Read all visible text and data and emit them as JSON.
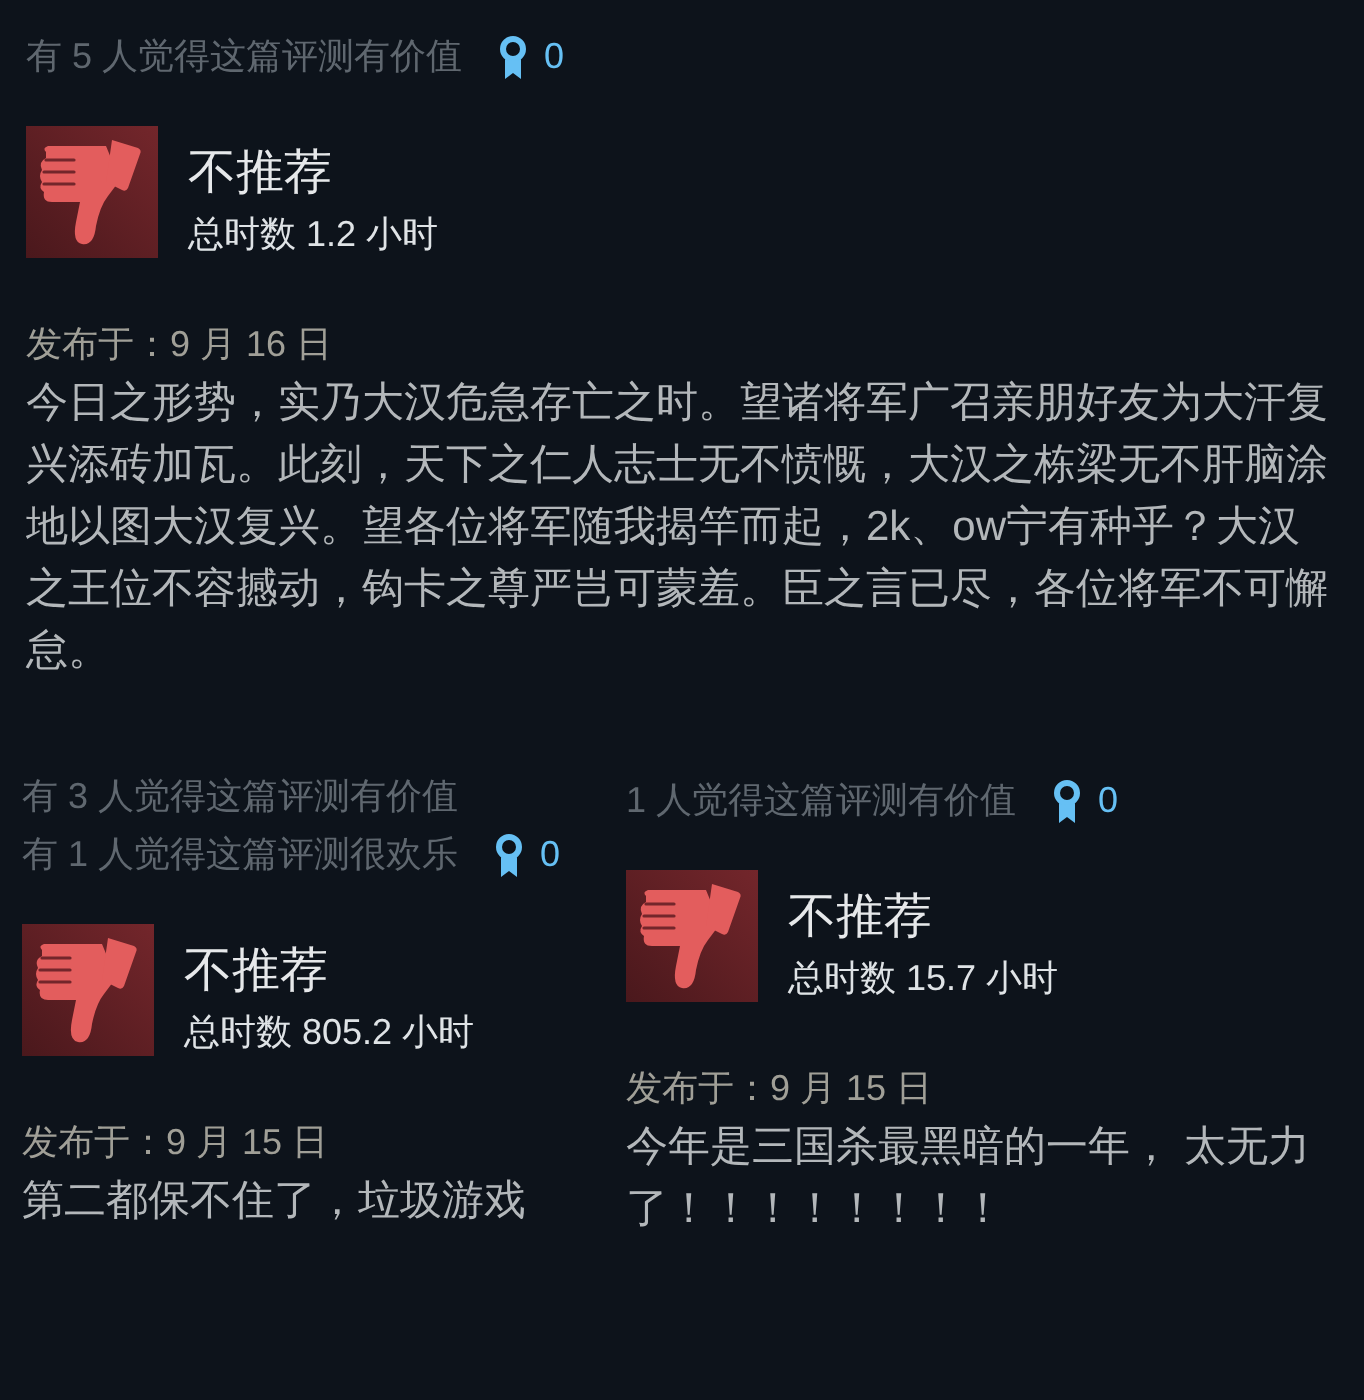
{
  "reviews": [
    {
      "helpful": [
        "有 5 人觉得这篇评测有价值"
      ],
      "awards": "0",
      "recommended": false,
      "verdict": "不推荐",
      "playtime": "总时数 1.2 小时",
      "posted": "发布于：9 月 16 日",
      "body": "今日之形势，实乃大汉危急存亡之时。望诸将军广召亲朋好友为大汗复兴添砖加瓦。此刻，天下之仁人志士无不愤慨，大汉之栋梁无不肝脑涂地以图大汉复兴。望各位将军随我揭竿而起，2k、ow宁有种乎？大汉之王位不容撼动，钩卡之尊严岂可蒙羞。臣之言已尽，各位将军不可懈怠。"
    },
    {
      "helpful": [
        "有 3 人觉得这篇评测有价值",
        "有 1 人觉得这篇评测很欢乐"
      ],
      "awards": "0",
      "recommended": false,
      "verdict": "不推荐",
      "playtime": "总时数 805.2 小时",
      "posted": "发布于：9 月 15 日",
      "body": "第二都保不住了，垃圾游戏"
    },
    {
      "helpful": [
        "1 人觉得这篇评测有价值"
      ],
      "awards": "0",
      "recommended": false,
      "verdict": "不推荐",
      "playtime": "总时数 15.7 小时",
      "posted": "发布于：9 月 15 日",
      "body": "今年是三国杀最黑暗的一年， 太无力了！！！！！！！！"
    }
  ]
}
